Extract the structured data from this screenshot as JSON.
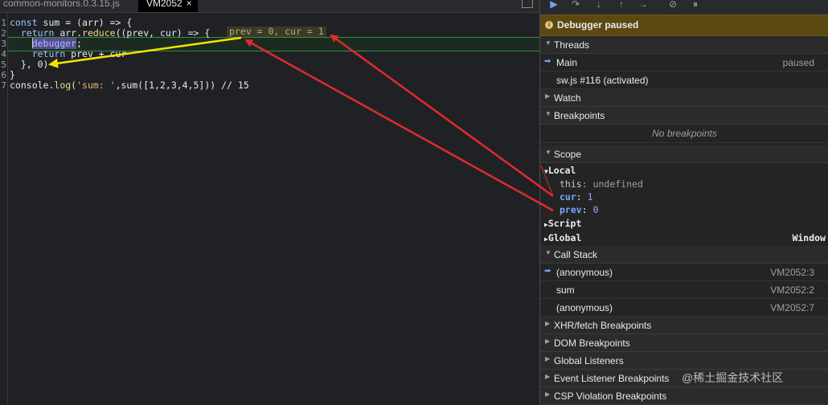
{
  "tabs": [
    {
      "label": "common-monitors.0.3.15.js",
      "active": false
    },
    {
      "label": "VM2052",
      "close": "×",
      "active": true
    }
  ],
  "code": {
    "line_numbers": [
      "1",
      "2",
      "3",
      "4",
      "5",
      "6",
      "7"
    ],
    "line1": {
      "kw": "const",
      "rest": " sum = (arr) => {"
    },
    "line2": {
      "kw": "return",
      "a": " arr.",
      "fn": "reduce",
      "b": "((prev, cur) => {"
    },
    "inline_values": "prev = 0, cur = 1",
    "line3": {
      "kw": "debugger",
      "b": ";"
    },
    "line4": {
      "kw": "return",
      "b": " prev + cur"
    },
    "line5": "}, 0)",
    "line6": "}",
    "line7": {
      "a": "console.",
      "fn": "log",
      "b": "(",
      "str": "'sum: '",
      "c": ",sum([1,2,3,4,5]))",
      "cm": " // 15"
    }
  },
  "toolbar": {
    "resume_icon": "resume-icon",
    "step_over_icon": "step-over-icon",
    "step_into_icon": "step-into-icon",
    "step_out_icon": "step-out-icon",
    "step_icon": "step-icon",
    "deactivate_icon": "deactivate-breakpoints-icon",
    "pause_exceptions_icon": "pause-on-exceptions-icon"
  },
  "banner": {
    "icon": "i",
    "text": "Debugger paused"
  },
  "sections": {
    "threads": "Threads",
    "watch": "Watch",
    "breakpoints": "Breakpoints",
    "scope": "Scope",
    "call_stack": "Call Stack",
    "xhr": "XHR/fetch Breakpoints",
    "dom": "DOM Breakpoints",
    "global_listeners": "Global Listeners",
    "event_listener": "Event Listener Breakpoints",
    "csp": "CSP Violation Breakpoints"
  },
  "threads": [
    {
      "name": "Main",
      "status": "paused",
      "current": true
    },
    {
      "name": "sw.js #116 (activated)",
      "status": "",
      "current": false
    }
  ],
  "breakpoints_empty": "No breakpoints",
  "scope": {
    "local_label": "Local",
    "this_name": "this",
    "this_value": "undefined",
    "cur_name": "cur",
    "cur_value": "1",
    "prev_name": "prev",
    "prev_value": "0",
    "script_label": "Script",
    "global_label": "Global",
    "global_value": "Window"
  },
  "call_stack": [
    {
      "fn": "(anonymous)",
      "loc": "VM2052:3",
      "current": true
    },
    {
      "fn": "sum",
      "loc": "VM2052:2",
      "current": false
    },
    {
      "fn": "(anonymous)",
      "loc": "VM2052:7",
      "current": false
    }
  ],
  "watermark": "@稀土掘金技术社区",
  "colors": {
    "paused_banner": "#5c4811",
    "annotation_red": "#e02b2b",
    "annotation_yellow": "#f2e600",
    "exec_line": "#2f8f46"
  }
}
